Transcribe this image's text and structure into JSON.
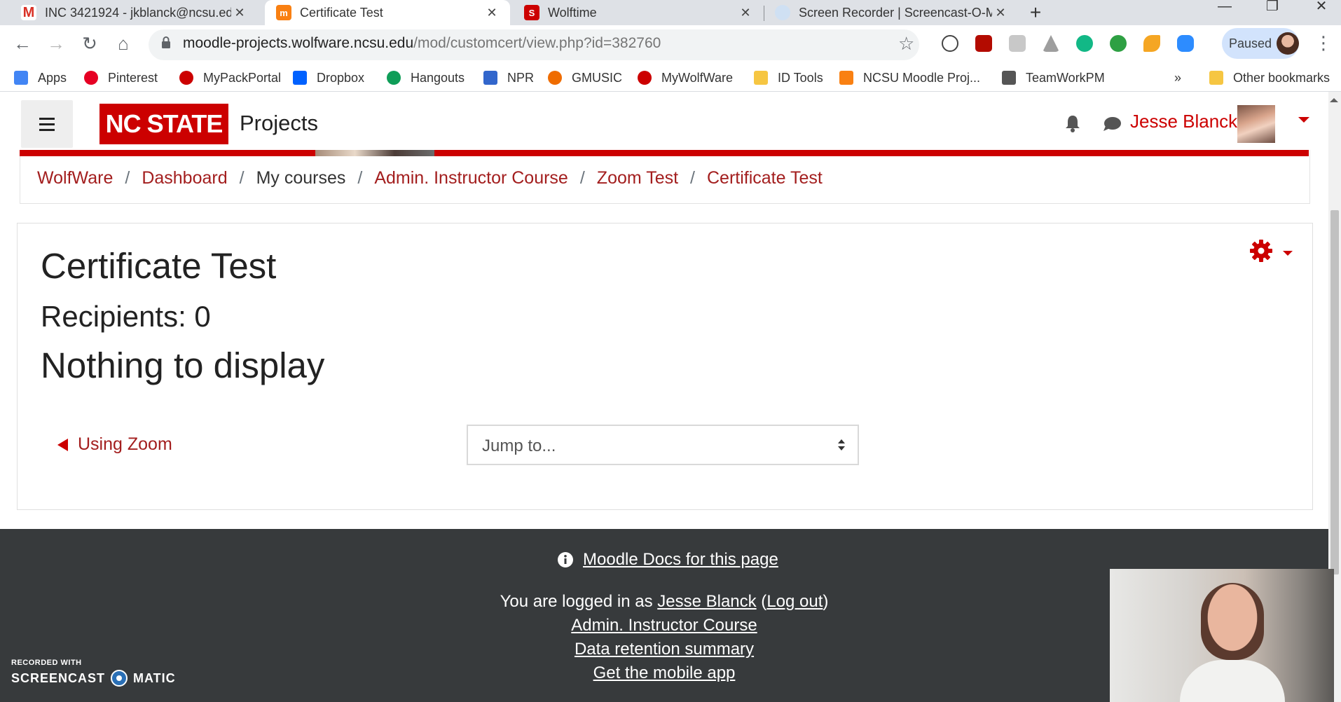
{
  "browser": {
    "tabs": [
      {
        "title": "INC 3421924 - jkblanck@ncsu.ed",
        "icon": "gmail-icon",
        "color": "#d93025",
        "close": "✕"
      },
      {
        "title": "Certificate Test",
        "icon": "moodle-icon",
        "color": "#f98012",
        "close": "✕"
      },
      {
        "title": "Wolftime",
        "icon": "wolfware-icon",
        "color": "#cc0000",
        "close": "✕"
      },
      {
        "title": "Screen Recorder | Screencast-O-M",
        "icon": "screencast-icon",
        "color": "#4a90d9",
        "close": "✕"
      }
    ],
    "new_tab": "+",
    "window_controls": [
      "—",
      "❐",
      "✕"
    ],
    "url_domain": "moodle-projects.wolfware.ncsu.edu",
    "url_path": "/mod/customcert/view.php?id=382760",
    "paused_label": "Paused",
    "bookmarks": [
      {
        "label": "Apps",
        "color": "#4285f4"
      },
      {
        "label": "Pinterest",
        "color": "#e60023"
      },
      {
        "label": "MyPackPortal",
        "color": "#cc0000"
      },
      {
        "label": "Dropbox",
        "color": "#0061ff"
      },
      {
        "label": "Hangouts",
        "color": "#0f9d58"
      },
      {
        "label": "NPR",
        "color": "#3266cc"
      },
      {
        "label": "GMUSIC",
        "color": "#ef6c00"
      },
      {
        "label": "MyWolfWare",
        "color": "#cc0000"
      },
      {
        "label": "ID Tools",
        "color": "#f6c642"
      },
      {
        "label": "NCSU Moodle Proj...",
        "color": "#f98012"
      },
      {
        "label": "TeamWorkPM",
        "color": "#555555"
      }
    ],
    "bookmarks_overflow": "»",
    "other_bookmarks": "Other bookmarks"
  },
  "site": {
    "logo_text": "NC STATE",
    "name": "Projects",
    "user_name": "Jesse Blanck",
    "accent_color": "#cc0000"
  },
  "breadcrumb": [
    {
      "label": "WolfWare",
      "link": true
    },
    {
      "label": "Dashboard",
      "link": true
    },
    {
      "label": "My courses",
      "link": false
    },
    {
      "label": "Admin. Instructor Course",
      "link": true
    },
    {
      "label": "Zoom Test",
      "link": true
    },
    {
      "label": "Certificate Test",
      "link": true
    }
  ],
  "main": {
    "title": "Certificate Test",
    "recipients": "Recipients: 0",
    "empty_message": "Nothing to display",
    "prev_activity": "Using Zoom",
    "jump_placeholder": "Jump to..."
  },
  "footer": {
    "docs_link": "Moodle Docs for this page",
    "logged_in_prefix": "You are logged in as ",
    "logged_in_user": "Jesse Blanck",
    "open_paren": " (",
    "logout": "Log out",
    "close_paren": ")",
    "course_link": "Admin. Instructor Course",
    "retention_link": "Data retention summary",
    "mobile_link": "Get the mobile app"
  },
  "watermark": {
    "line1": "RECORDED WITH",
    "brand_left": "SCREENCAST",
    "brand_right": "MATIC"
  }
}
